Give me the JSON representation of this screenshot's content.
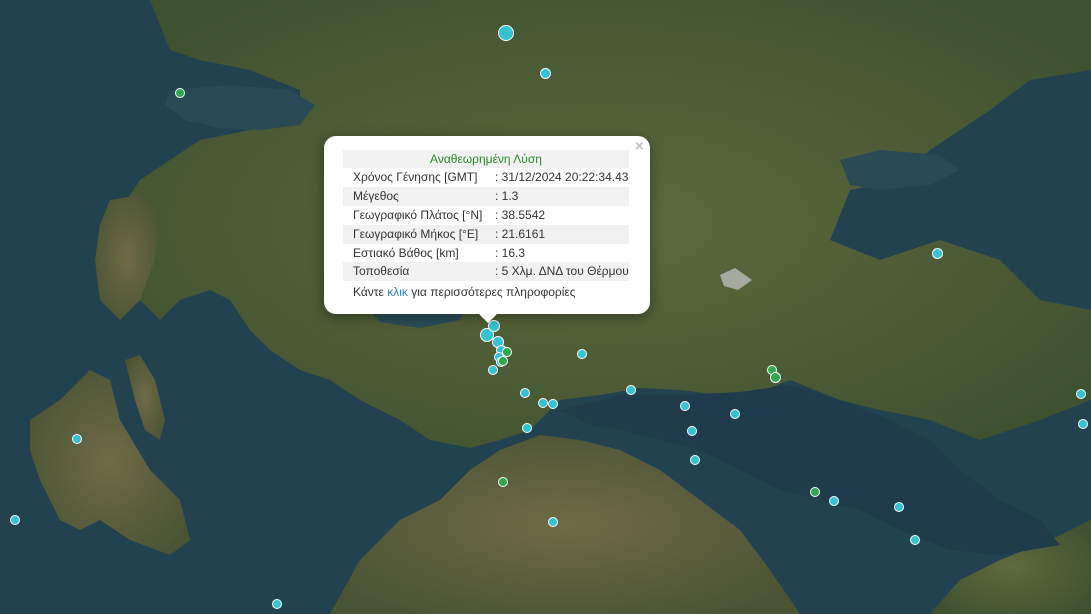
{
  "popup": {
    "title": "Αναθεωρημένη Λύση",
    "rows": [
      {
        "label": "Χρόνος Γένησης [GMT]",
        "value": ": 31/12/2024 20:22:34.43"
      },
      {
        "label": "Μέγεθος",
        "value": ": 1.3"
      },
      {
        "label": "Γεωγραφικό Πλάτος [°N]",
        "value": ": 38.5542"
      },
      {
        "label": "Γεωγραφικό Μήκος [°E]",
        "value": ": 21.6161"
      },
      {
        "label": "Εστιακό Βάθος [km]",
        "value": ": 16.3"
      },
      {
        "label": "Τοποθεσία",
        "value": ": 5 Χλμ. ΔΝΔ του Θέρμου"
      }
    ],
    "more_prefix": "Κάντε",
    "more_link": "κλικ",
    "more_suffix": "για περισσότερες πληροφορίες",
    "close_symbol": "×"
  },
  "colors": {
    "marker_cyan": "#35c2d3",
    "marker_green": "#2fa84f",
    "title_green": "#2a8a2a",
    "link_blue": "#2a7fc2"
  }
}
